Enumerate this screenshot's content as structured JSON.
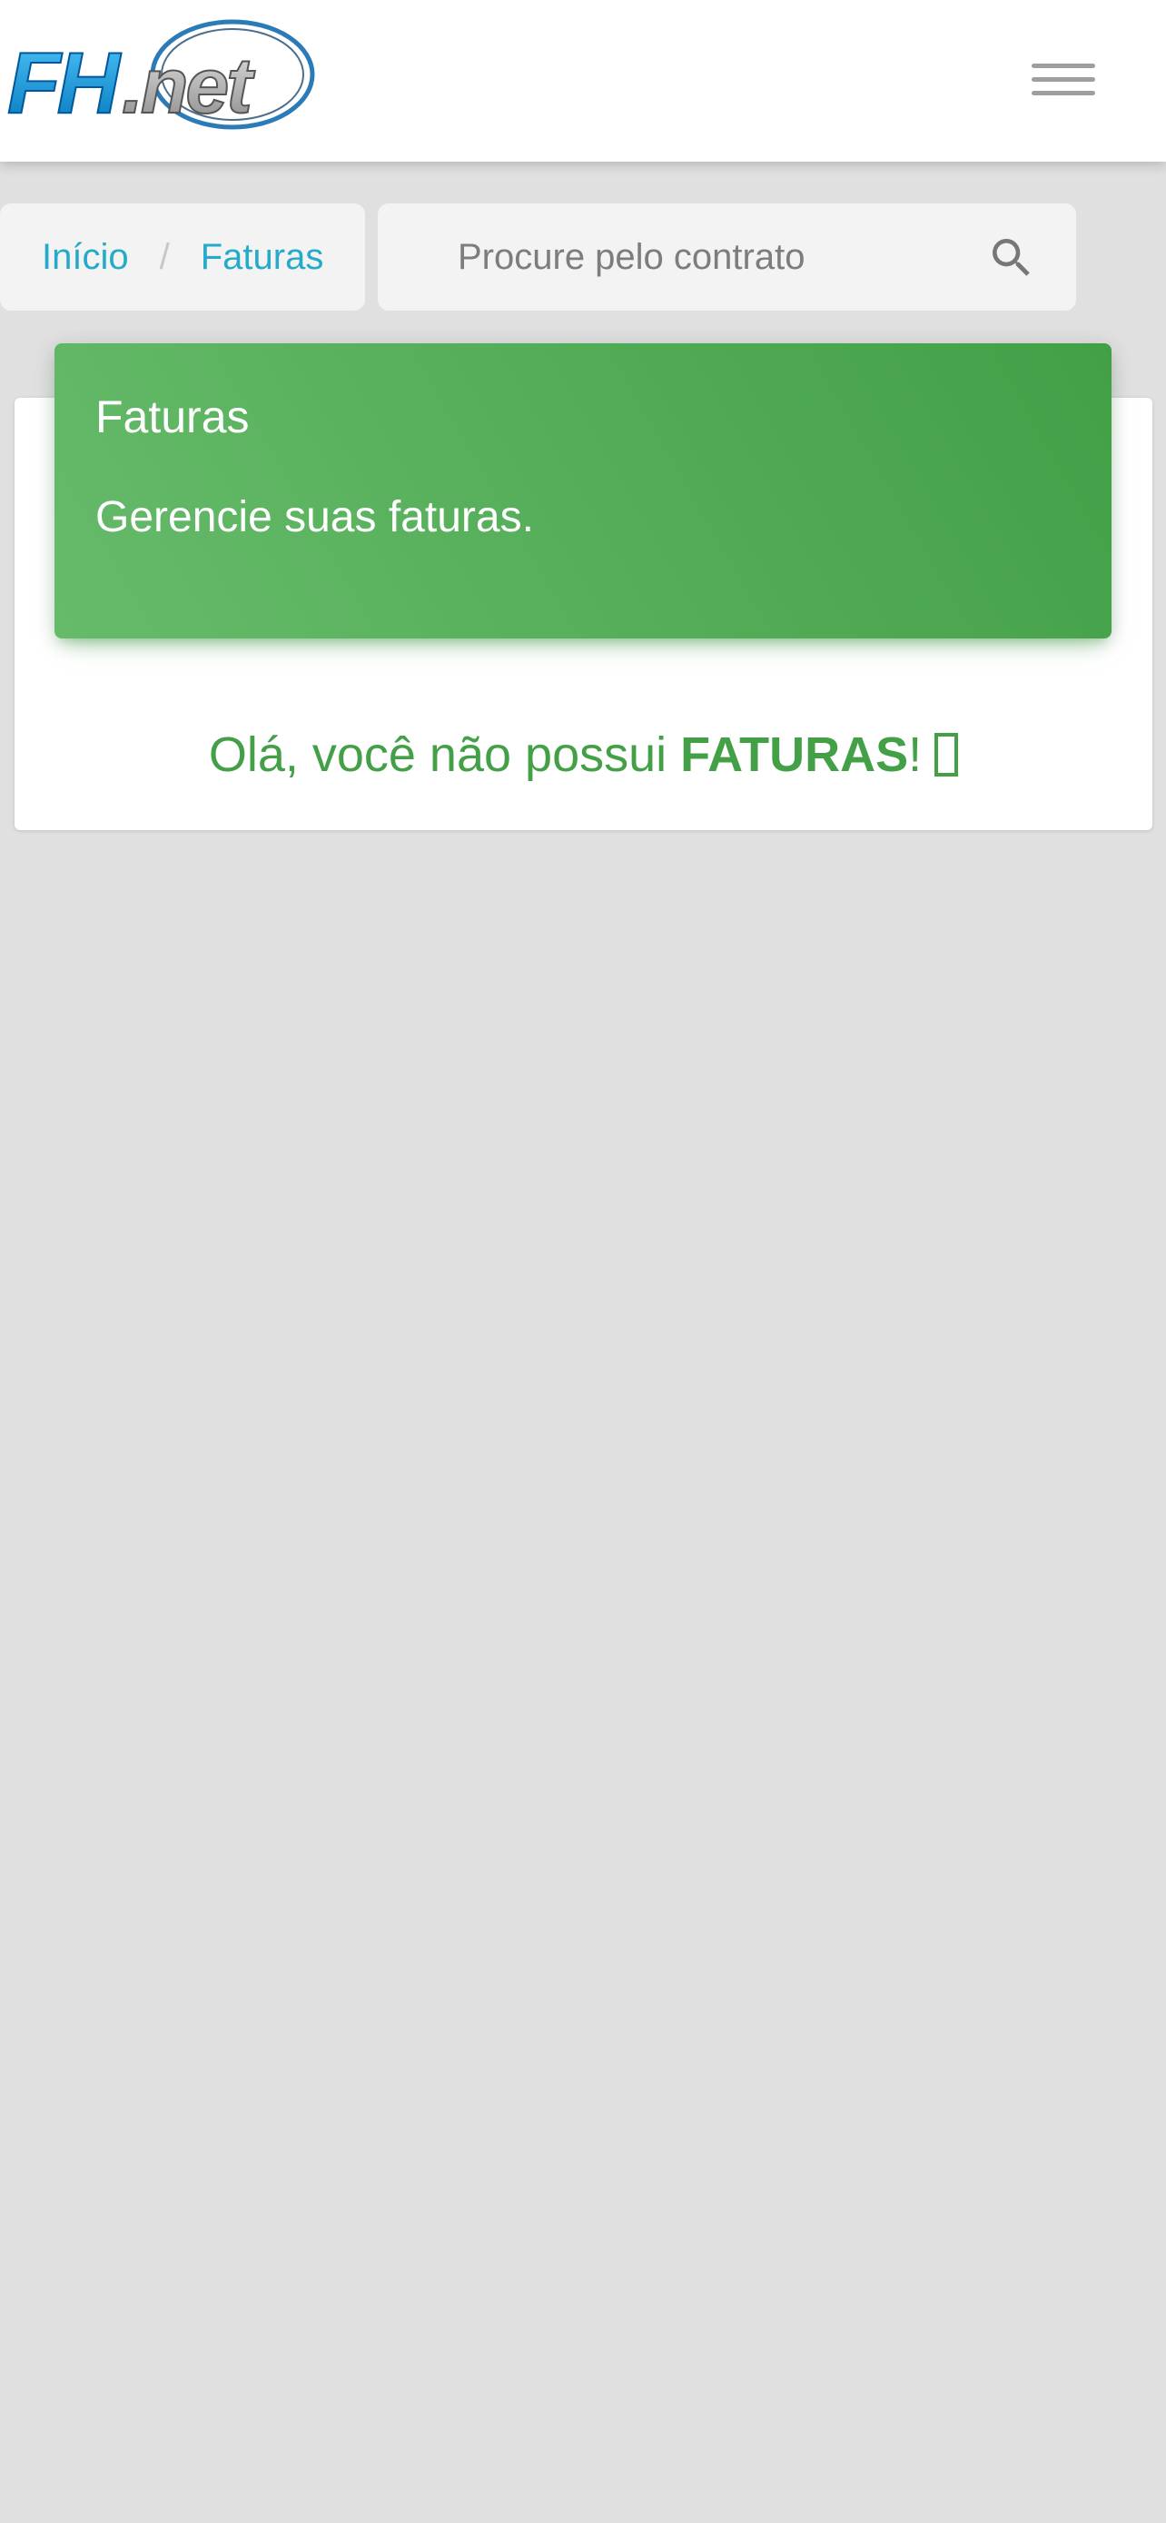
{
  "header": {
    "logo_text": "FH.net",
    "menu_icon": "hamburger-menu-icon"
  },
  "breadcrumb": {
    "items": [
      {
        "label": "Início"
      },
      {
        "label": "Faturas"
      }
    ],
    "separator": "/"
  },
  "search": {
    "placeholder": "Procure pelo contrato",
    "value": "",
    "icon": "search-icon"
  },
  "card": {
    "title": "Faturas",
    "category": "Gerencie suas faturas.",
    "empty_message_prefix": "Olá, você não possui ",
    "empty_message_emphasis": "FATURAS",
    "empty_message_suffix": "!",
    "empty_message_glyph": "missing-glyph-icon"
  },
  "colors": {
    "accent_green": "#43a047",
    "link_blue": "#26aac9",
    "background": "#e0e0e0"
  }
}
